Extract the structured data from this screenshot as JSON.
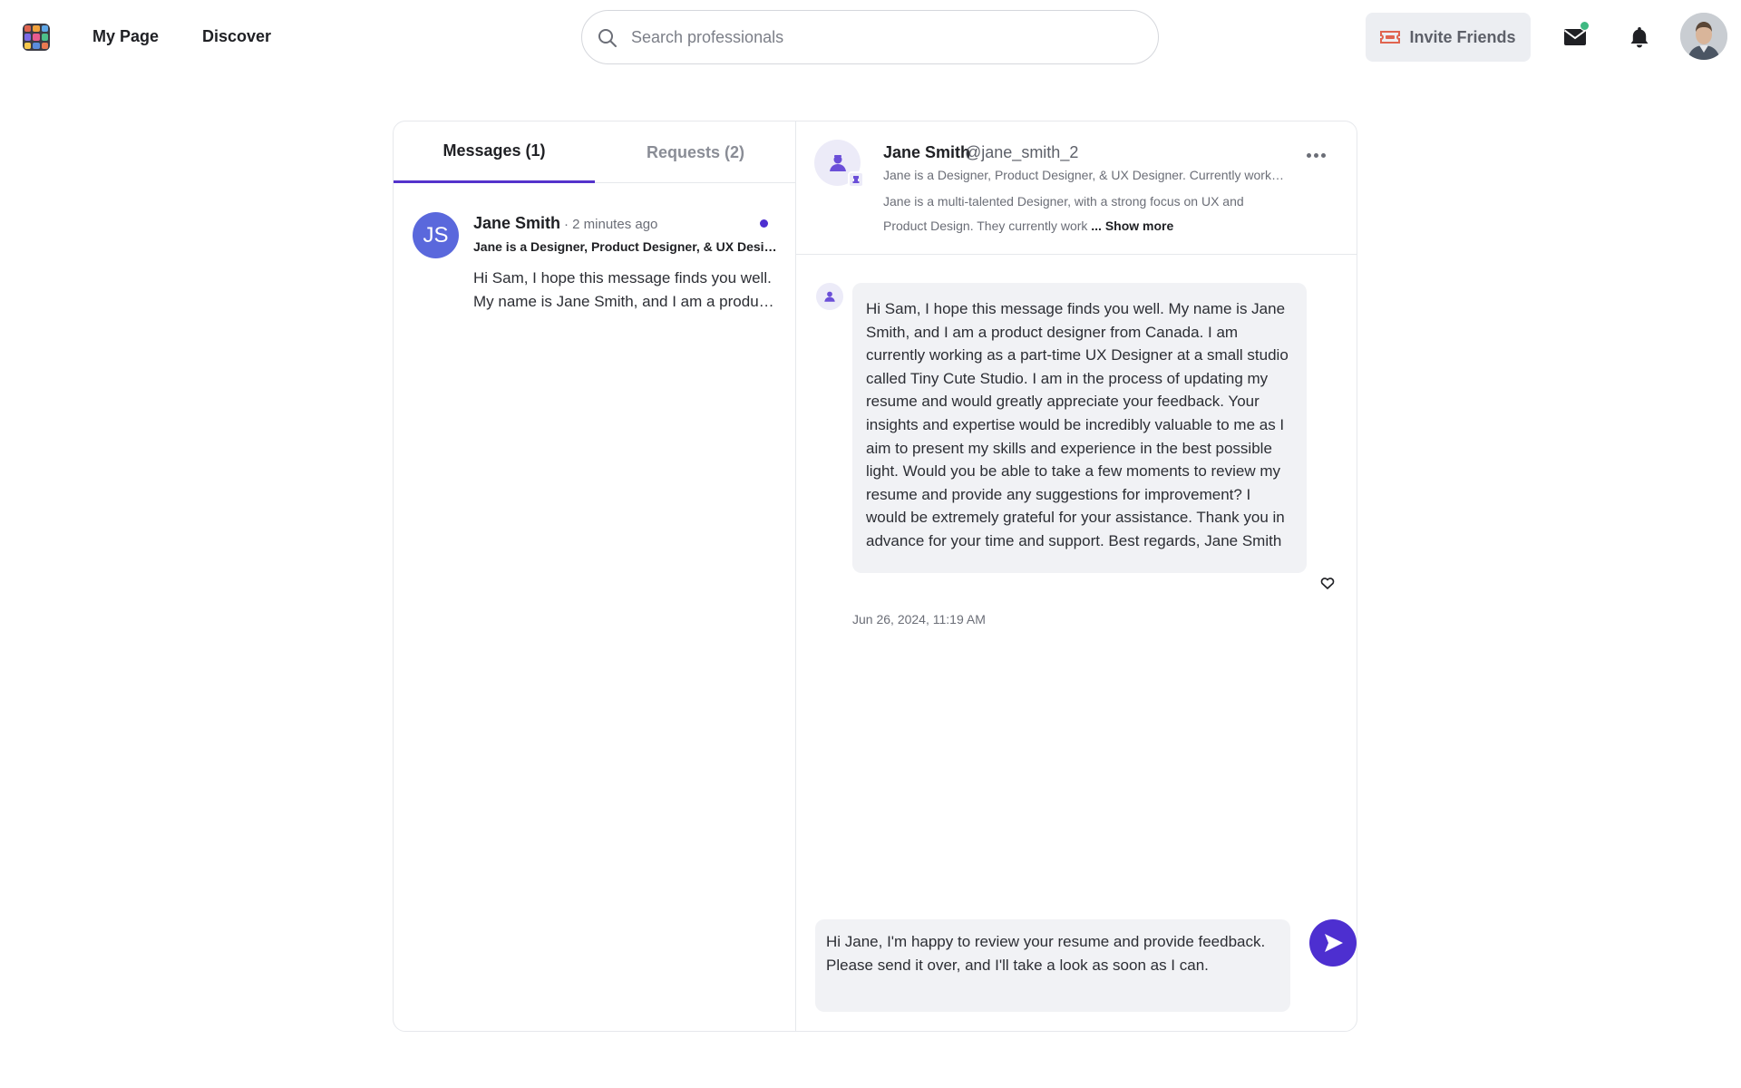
{
  "nav": {
    "my_page": "My Page",
    "discover": "Discover",
    "search_placeholder": "Search professionals",
    "invite_label": "Invite Friends",
    "icons": [
      "app-logo-icon",
      "search-icon",
      "ticket-icon",
      "mail-icon",
      "bell-icon"
    ],
    "mail_unread_dot_color": "#3fb982"
  },
  "tabs": {
    "messages": "Messages  (1)",
    "requests": "Requests  (2)",
    "active": "messages",
    "accent_color": "#5433cc"
  },
  "conversation": {
    "initials": "JS",
    "name": "Jane Smith",
    "time": "· 2 minutes ago",
    "headline": "Jane is a Designer, Product Designer, & UX Designer. Currently working as a part-time UX Designer",
    "preview": "Hi Sam, I hope this message finds you well. My name is Jane Smith, and I am a product designer from Canada.",
    "unread": true,
    "avatar_color": "#5a68dc"
  },
  "chat_header": {
    "name": "Jane Smith",
    "handle": "@jane_smith_2",
    "headline": "Jane is a Designer, Product Designer, & UX Designer. Currently working as a part-time UX Designer",
    "bio": "Jane is a multi-talented Designer, with a strong focus on UX and Product Design. They currently work",
    "show_more": "... Show more"
  },
  "message": {
    "text": "Hi Sam, I hope this message finds you well. My name is Jane Smith, and I am a product designer from Canada. I am currently working as a part-time UX Designer at a small studio called Tiny Cute Studio. I am in the process of updating my resume and would greatly appreciate your feedback. Your insights and expertise would be incredibly valuable to me as I aim to present my skills and experience in the best possible light. Would you be able to take a few moments to review my resume and provide any suggestions for improvement? I would be extremely grateful for your assistance. Thank you in advance for your time and support. Best regards, Jane Smith",
    "timestamp": "Jun 26, 2024, 11:19 AM"
  },
  "composer": {
    "draft": "Hi Jane, I'm happy to review your resume and provide feedback. Please send it over, and I'll take a look as soon as I can.",
    "send_color": "#4d2fd0"
  }
}
